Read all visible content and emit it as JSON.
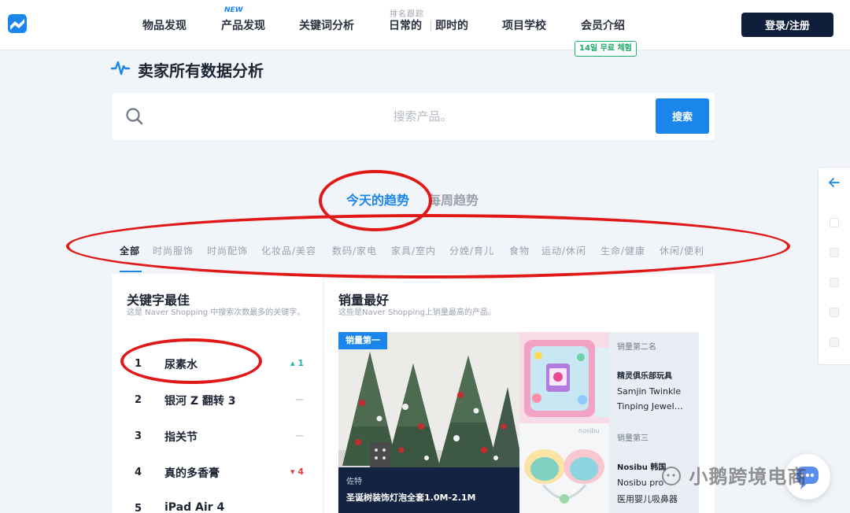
{
  "nav": {
    "items": [
      "物品发现",
      "产品发现",
      "关键词分析",
      "日常的",
      "即时的",
      "项目学校",
      "会员介绍"
    ],
    "new_badge": "NEW",
    "rank_label": "排名跟踪",
    "trial_badge": "14일 무료 체험",
    "login_label": "登录/注册"
  },
  "page": {
    "title": "卖家所有数据分析"
  },
  "search": {
    "placeholder": "搜索产品。",
    "button_label": "搜索"
  },
  "trends": {
    "tabs": [
      "今天的趋势",
      "每周趋势"
    ],
    "active_tab": "今天的趋势"
  },
  "categories": [
    "全部",
    "时尚服饰",
    "时尚配饰",
    "化妆品/美容",
    "数码/家电",
    "家具/室内",
    "分娩/育儿",
    "食物",
    "运动/休闲",
    "生命/健康",
    "休闲/便利"
  ],
  "keywords_panel": {
    "title": "关键字最佳",
    "subtitle": "这是 Naver Shopping 中搜索次数最多的关键字。",
    "items": [
      {
        "rank": "1",
        "keyword": "尿素水",
        "change": "▴ 1",
        "trend": "up"
      },
      {
        "rank": "2",
        "keyword": "银河 Z 翻转 3",
        "change": "—",
        "trend": "flat"
      },
      {
        "rank": "3",
        "keyword": "指关节",
        "change": "—",
        "trend": "flat"
      },
      {
        "rank": "4",
        "keyword": "真的多香膏",
        "change": "▾ 4",
        "trend": "down"
      },
      {
        "rank": "5",
        "keyword": "iPad Air 4",
        "change": "",
        "trend": "flat"
      }
    ]
  },
  "bestsellers_panel": {
    "title": "销量最好",
    "subtitle": "这些是Naver Shopping上销量最高的产品。",
    "first": {
      "rank_label": "销量第一",
      "brand": "佐特",
      "name": "圣诞树装饰灯泡全套1.0M-2.1M"
    },
    "second": {
      "rank_label": "销量第二名",
      "brand": "精灵俱乐部玩具",
      "line1": "Samjin Twinkle",
      "line2": "Tinping Jewel…"
    },
    "third": {
      "rank_label": "销量第三",
      "brand": "Nosibu 韩国",
      "line1": "Nosibu pro",
      "line2": "医用婴儿吸鼻器",
      "img_text": "nosibu"
    }
  },
  "watermark": "小鹅跨境电商",
  "colors": {
    "accent": "#1a86ec",
    "nav_button": "#0f1f3b",
    "annotation": "#e11818"
  }
}
